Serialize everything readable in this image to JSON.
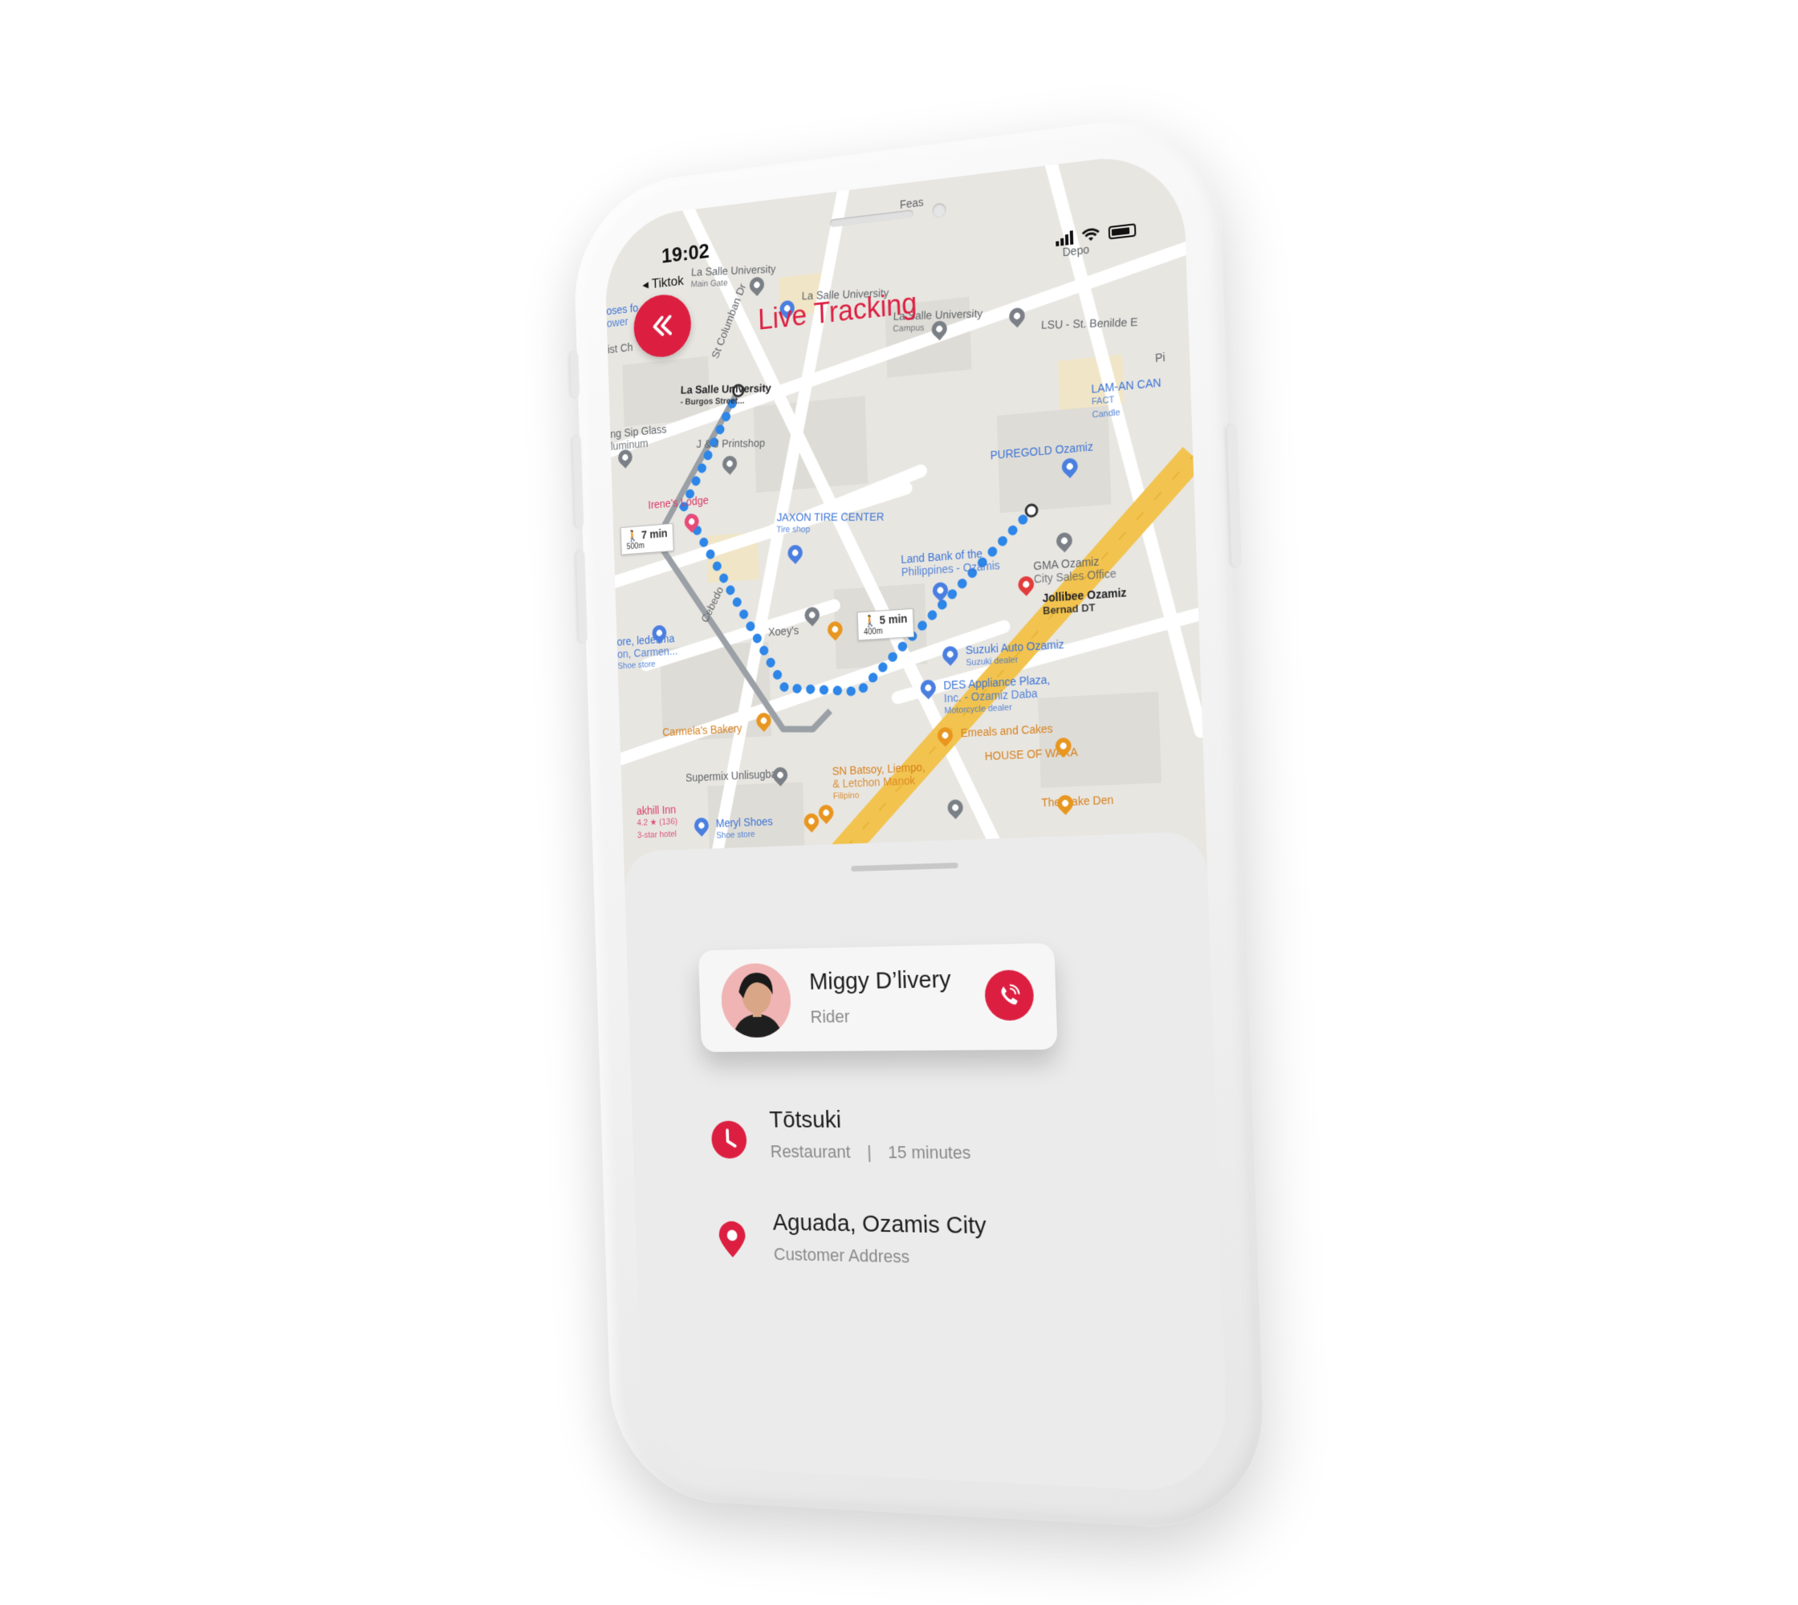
{
  "status_bar": {
    "time": "19:02",
    "back_app": "◂ Tiktok"
  },
  "header": {
    "title": "Live Tracking"
  },
  "map": {
    "labels": {
      "feas": "Feas",
      "lasalle_main_gate": "La Salle University",
      "lasalle_main_gate_sub": "Main Gate",
      "lasalle_university": "La Salle University",
      "lasalle_campus": "La Salle University",
      "lasalle_campus_sub": "Campus",
      "lsu_benilde": "LSU - St. Benilde E",
      "depo": "Depo",
      "burgos": "La Salle University",
      "burgos_sub": "- Burgos Street...",
      "sip_glass": "ng Sip Glass",
      "sip_glass_sub": "luminum",
      "jj_print": "J & J Printshop",
      "irenes": "Irene's Lodge",
      "lam_an": "LAM-AN CAN",
      "lam_an_sub": "FACT",
      "lam_an_sub2": "Candle",
      "puregold": "PUREGOLD Ozamiz",
      "jaxon": "JAXON TIRE CENTER",
      "jaxon_sub": "Tire shop",
      "landbank": "Land Bank of the",
      "landbank_sub": "Philippines - Ozamis",
      "gma": "GMA Ozamiz",
      "gma_sub": "City Sales Office",
      "jollibee": "Jollibee Ozamiz",
      "jollibee_sub": "Bernad DT",
      "ledesma": "ore, ledesma",
      "ledesma_sub": "on, Carmen...",
      "ledesma_sub2": "Shoe store",
      "xoeys": "Xoey's",
      "suzuki": "Suzuki Auto Ozamiz",
      "suzuki_sub": "Suzuki dealer",
      "des": "DES Appliance Plaza,",
      "des_sub": "Inc. - Ozamiz Daba",
      "des_sub2": "Motorcycle dealer",
      "carmelas": "Carmela's Bakery",
      "emeals": "Emeals and Cakes",
      "house_waka": "HOUSE OF WAKA",
      "supermix": "Supermix Unlisugba",
      "sn_batsoy": "SN Batsoy, Liempo,",
      "sn_batsoy_sub": "& Letchon Manok",
      "sn_batsoy_sub2": "Filipino",
      "cake_den": "The Cake Den",
      "oakhill": "akhill Inn",
      "oakhill_sub": "4.2 ★ (136)",
      "oakhill_sub2": "3-star hotel",
      "meryl": "Meryl Shoes",
      "meryl_sub": "Shoe store",
      "cebedo": "Cebedo",
      "columban": "St Columban Dr",
      "oses": "oses fo",
      "ower": "ower",
      "ist": "ist Ch",
      "pi": "Pi"
    },
    "walk_badges": [
      {
        "time": "7 min",
        "distance": "500m"
      },
      {
        "time": "5 min",
        "distance": "400m"
      }
    ]
  },
  "rider": {
    "name": "Miggy D’livery",
    "role": "Rider"
  },
  "restaurant": {
    "name": "Tōtsuki",
    "type": "Restaurant",
    "separator": "|",
    "eta": "15 minutes"
  },
  "address": {
    "line": "Aguada, Ozamis City",
    "label": "Customer Address"
  },
  "colors": {
    "accent": "#dc1f41",
    "route_blue": "#2d86e8",
    "route_gray": "#9aa0a6",
    "main_road": "#f2c34e"
  }
}
